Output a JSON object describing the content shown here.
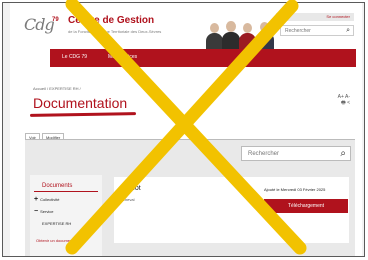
{
  "header": {
    "logo_text": "Cdg",
    "logo_sup": "79",
    "brand_title": "Centre de Gestion",
    "brand_subtitle": "de la Fonction Publique Territoriale des Deux-Sèvres",
    "topbar_link": "Se connecter",
    "search_placeholder": "Rechercher"
  },
  "nav": {
    "items": [
      "Le CDG 79",
      "Mes services"
    ]
  },
  "page": {
    "breadcrumb": "Accueil / EXPERTISE RH /",
    "title": "Documentation",
    "tools_line1": "A+ A-",
    "tools_line2": "🖶 <"
  },
  "tabs": [
    "Voir",
    "Modifier"
  ],
  "content": {
    "search_placeholder": "Rechercher"
  },
  "sidebar": {
    "title": "Documents",
    "items": [
      {
        "sign": "+",
        "label": "Collectivité"
      },
      {
        "sign": "−",
        "label": "Service"
      },
      {
        "sign": "",
        "label": "EXPERTISE RH"
      }
    ],
    "last_link": "Obtenir un document"
  },
  "card": {
    "title": "Dépot",
    "meta": "Cheval",
    "date": "Ajouté le Mercredi 03 Février 2025",
    "button_label": "Téléchargement"
  },
  "colors": {
    "brand_red": "#b0121d",
    "overlay_cross": "#f2c200"
  }
}
